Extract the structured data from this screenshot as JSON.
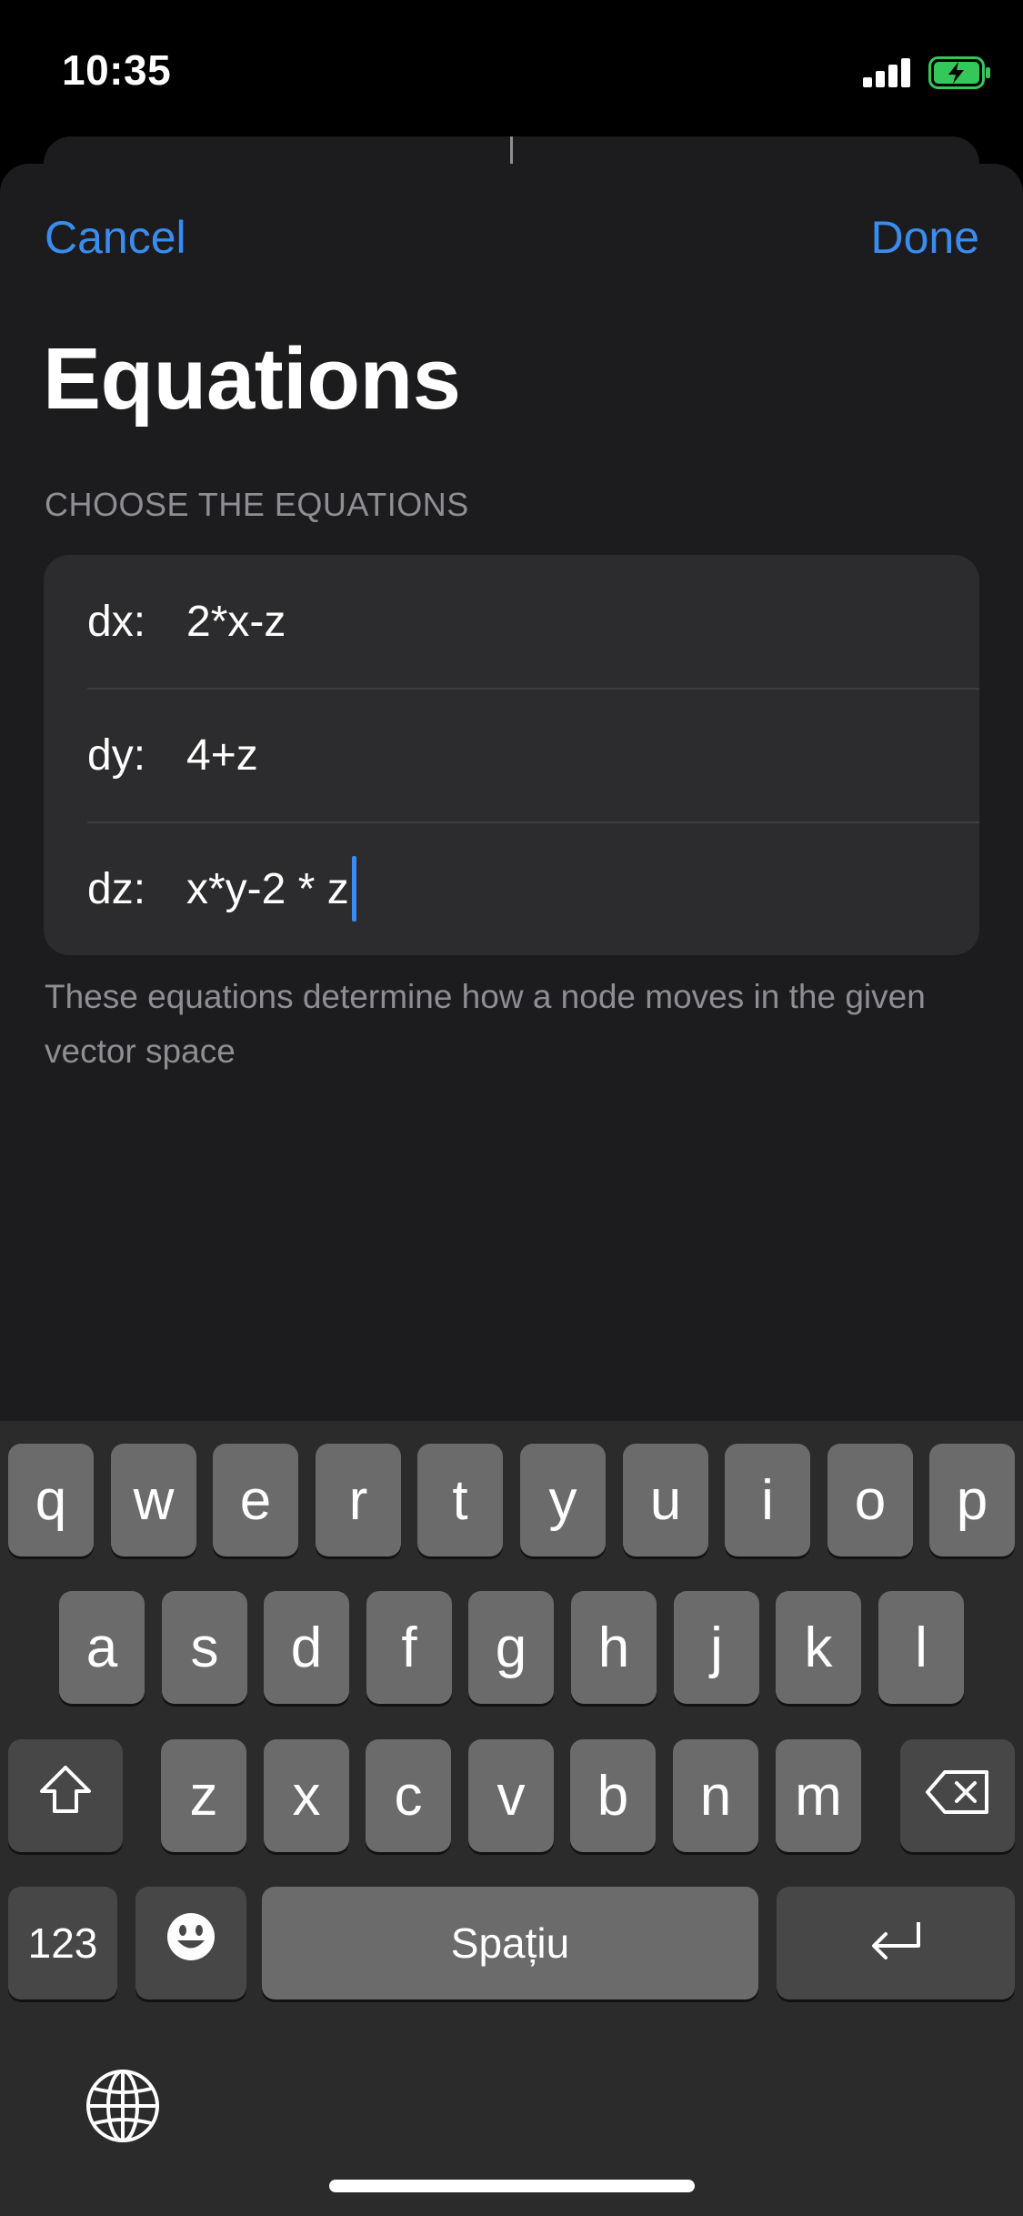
{
  "status_bar": {
    "time": "10:35",
    "signal_icon": "cellular-signal-icon",
    "battery_icon": "battery-charging-icon",
    "battery_color": "#34c759"
  },
  "sheet": {
    "cancel_label": "Cancel",
    "done_label": "Done",
    "title": "Equations",
    "section_header": "CHOOSE THE EQUATIONS",
    "fields": [
      {
        "label": "dx:",
        "value": "2*x-z"
      },
      {
        "label": "dy:",
        "value": "4+z"
      },
      {
        "label": "dz:",
        "value": "x*y-2 * z"
      }
    ],
    "footer": "These equations determine how a node moves in the given vector space"
  },
  "keyboard": {
    "row1": [
      "q",
      "w",
      "e",
      "r",
      "t",
      "y",
      "u",
      "i",
      "o",
      "p"
    ],
    "row2": [
      "a",
      "s",
      "d",
      "f",
      "g",
      "h",
      "j",
      "k",
      "l"
    ],
    "row3": [
      "z",
      "x",
      "c",
      "v",
      "b",
      "n",
      "m"
    ],
    "numbers_label": "123",
    "space_label": "Spațiu",
    "shift_icon": "shift-icon",
    "delete_icon": "delete-icon",
    "emoji_icon": "emoji-icon",
    "return_icon": "return-icon",
    "globe_icon": "globe-icon"
  },
  "colors": {
    "accent": "#3a8cf0",
    "sheet_background": "#1c1c1e",
    "group_background": "#2c2c2e",
    "secondary_text": "#8e8e93"
  }
}
